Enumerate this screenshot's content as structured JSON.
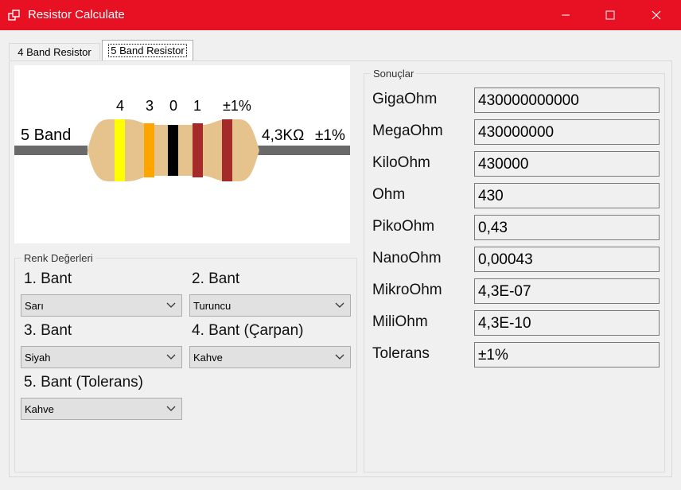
{
  "window": {
    "title": "Resistor Calculate",
    "titlebar_color": "#e81123",
    "icons": [
      "app-icon",
      "minimize-icon",
      "maximize-icon",
      "close-icon"
    ]
  },
  "tabs": [
    {
      "label": "4 Band Resistor",
      "selected": false
    },
    {
      "label": "5 Band Resistor",
      "selected": true
    }
  ],
  "diagram": {
    "left_label": "5 Band",
    "right_value": "4,3KΩ",
    "right_tolerance": "±1%",
    "band_labels": [
      "4",
      "3",
      "0",
      "1",
      "±1%"
    ],
    "band_colors": [
      "#ffff00",
      "#ffa500",
      "#000000",
      "#a52a2a",
      "#a52a2a"
    ],
    "body_color": "#e6c28c",
    "lead_color": "#696969"
  },
  "colors_group": {
    "title": "Renk Değerleri",
    "fields": [
      {
        "label": "1. Bant",
        "value": "Sarı"
      },
      {
        "label": "2. Bant",
        "value": "Turuncu"
      },
      {
        "label": "3. Bant",
        "value": "Siyah"
      },
      {
        "label": "4. Bant (Çarpan)",
        "value": "Kahve"
      },
      {
        "label": "5. Bant (Tolerans)",
        "value": "Kahve"
      }
    ]
  },
  "results_group": {
    "title": "Sonuçlar",
    "rows": [
      {
        "label": "GigaOhm",
        "value": "430000000000"
      },
      {
        "label": "MegaOhm",
        "value": "430000000"
      },
      {
        "label": "KiloOhm",
        "value": "430000"
      },
      {
        "label": "Ohm",
        "value": "430"
      },
      {
        "label": "PikoOhm",
        "value": "0,43"
      },
      {
        "label": "NanoOhm",
        "value": "0,00043"
      },
      {
        "label": "MikroOhm",
        "value": "4,3E-07"
      },
      {
        "label": "MiliOhm",
        "value": "4,3E-10"
      },
      {
        "label": "Tolerans",
        "value": "±1%"
      }
    ]
  }
}
